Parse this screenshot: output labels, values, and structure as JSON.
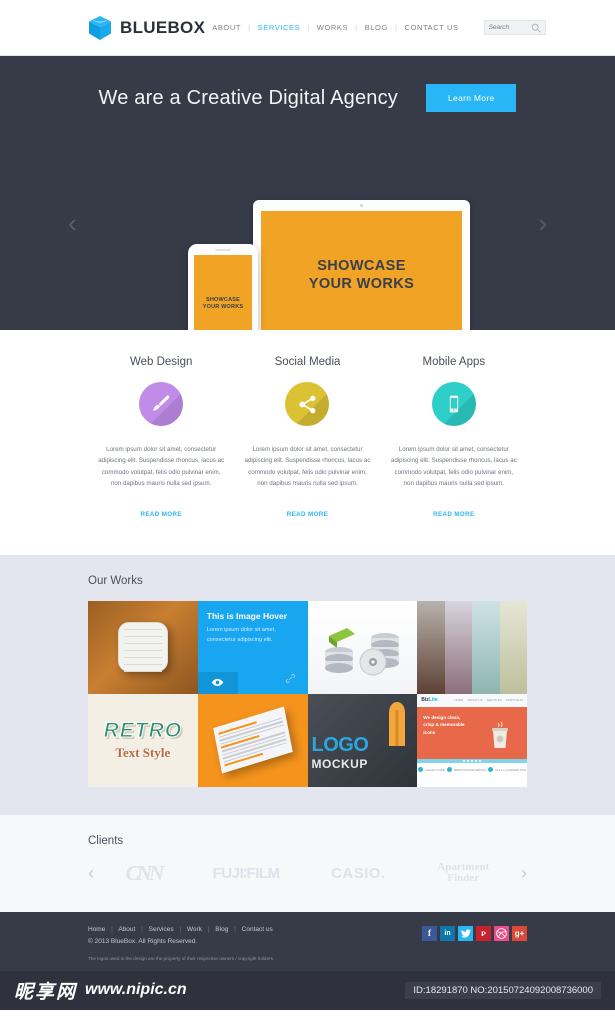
{
  "header": {
    "brand": "BLUEBOX",
    "logo_icon": "cube-icon",
    "nav": [
      {
        "label": "ABOUT",
        "active": false
      },
      {
        "label": "SERVICES",
        "active": true
      },
      {
        "label": "WORKS",
        "active": false
      },
      {
        "label": "BLOG",
        "active": false
      },
      {
        "label": "CONTACT US",
        "active": false
      }
    ],
    "separator": "|",
    "search": {
      "placeholder": "Search",
      "value": "",
      "icon": "search-icon"
    }
  },
  "hero": {
    "title": "We are a Creative Digital Agency",
    "button": "Learn More",
    "prev_arrow": "‹",
    "next_arrow": "›",
    "laptop_line1": "SHOWCASE",
    "laptop_line2": "YOUR WORKS",
    "phone_line1": "SHOWCASE",
    "phone_line2": "YOUR WORKS",
    "screen_color": "#f0a325",
    "bg_color": "#363b47",
    "accent_color": "#29b6f6"
  },
  "services": {
    "items": [
      {
        "title": "Web Design",
        "icon": "paintbrush-icon",
        "color": "#c08ce8",
        "body": "Lorem ipsum dolor sit amet, consectetur adipiscing elit. Suspendisse rhoncus, lacus ac commodo volutpat, felis odio pulvinar enim, non dapibus mauris nulla sed ipsum.",
        "link": "READ MORE"
      },
      {
        "title": "Social Media",
        "icon": "share-icon",
        "color": "#dbc134",
        "body": "Lorem ipsum dolor sit amet, consectetur adipiscing elit. Suspendisse rhoncus, lacus ac commodo volutpat, felis odio pulvinar enim, non dapibus mauris nulla sed ipsum.",
        "link": "READ MORE"
      },
      {
        "title": "Mobile Apps",
        "icon": "mobile-icon",
        "color": "#2ecfc9",
        "body": "Lorem ipsum dolor sit amet, consectetur adipiscing elit. Suspendisse rhoncus, lacus ac commodo volutpat, felis odio pulvinar enim, non dapibus mauris nulla sed ipsum.",
        "link": "READ MORE"
      }
    ]
  },
  "works": {
    "title": "Our Works",
    "hover_tile": {
      "heading": "This is Image Hover",
      "body": "Lorem ipsum dolor sit amet, consectetur adipiscing elit.",
      "zoom_icon": "eye-icon",
      "link_icon": "link-icon",
      "bg_color": "#18a6f0"
    },
    "retro_tile": {
      "line1": "RETRO",
      "line2": "Text Style"
    },
    "logo_tile": {
      "line1": "LOGO",
      "line2": "MOCKUP"
    },
    "site_tile": {
      "brand": "Biz",
      "brand_accent": "Lite",
      "headline": "We design clean, crisp & memorable icons",
      "nav": [
        "HOME",
        "ABOUT US",
        "SERVICES",
        "PORTFOLIO"
      ],
      "features": [
        "CLEAN CODE",
        "RESPONSIVE DESIGN",
        "FULLY LAYERED PSD"
      ]
    }
  },
  "clients": {
    "title": "Clients",
    "prev_arrow": "‹",
    "next_arrow": "›",
    "logos": [
      {
        "name": "CNN",
        "text": "CNN"
      },
      {
        "name": "FUJIFILM",
        "text": "FUJI∶FILM"
      },
      {
        "name": "CASIO",
        "text": "CASIO."
      },
      {
        "name": "Apartment Finder",
        "line1": "Apartment",
        "line2": "Finder"
      }
    ]
  },
  "footer": {
    "links": [
      "Home",
      "About",
      "Services",
      "Work",
      "Blog",
      "Contact us"
    ],
    "separator": "|",
    "copyright": "© 2013 BlueBox. All Rights Reserved.",
    "disclaimer": "The logos used in the design are the property of their respective owners / copyright holders.",
    "socials": [
      {
        "name": "facebook",
        "glyph": "f",
        "color": "#3b5998"
      },
      {
        "name": "linkedin",
        "glyph": "in",
        "color": "#0e76a8"
      },
      {
        "name": "twitter",
        "glyph": "ᵛ",
        "color": "#29b6f6"
      },
      {
        "name": "pinterest",
        "glyph": "ᴘ",
        "color": "#c8232c"
      },
      {
        "name": "dribbble",
        "glyph": "☸",
        "color": "#ea4c89"
      },
      {
        "name": "googleplus",
        "glyph": "g+",
        "color": "#db4a39"
      }
    ]
  },
  "watermark": {
    "cn_text": "昵享网",
    "url": "www.nipic.cn",
    "id_text": "ID:18291870 NO:20150724092008736000"
  }
}
